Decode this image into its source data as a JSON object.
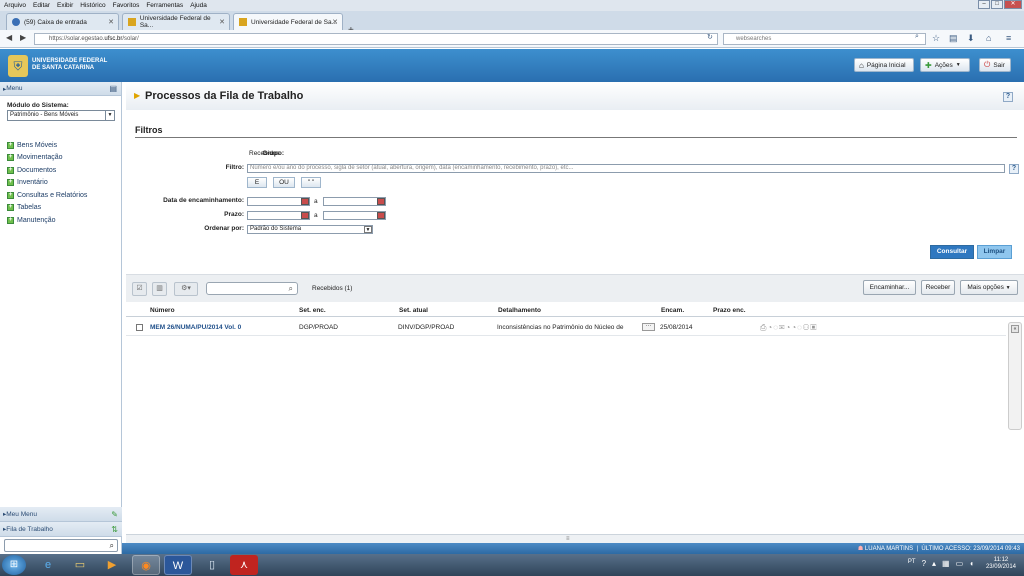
{
  "browser": {
    "menu": [
      "Arquivo",
      "Editar",
      "Exibir",
      "Histórico",
      "Favoritos",
      "Ferramentas",
      "Ajuda"
    ],
    "tabs": [
      {
        "label": "(59) Caixa de entrada"
      },
      {
        "label": "Universidade Federal de Sa..."
      },
      {
        "label": "Universidade Federal de Sa..."
      }
    ],
    "url_prefix": "https://solar.egestao.",
    "url_domain": "ufsc.br",
    "url_suffix": "/solar/",
    "search_placeholder": "websearches"
  },
  "header": {
    "university_line1": "UNIVERSIDADE FEDERAL",
    "university_line2": "DE SANTA CATARINA",
    "btn_home": "Página Inicial",
    "btn_actions": "Ações",
    "btn_exit": "Sair"
  },
  "sidebar": {
    "menu_title": "Menu",
    "module_label": "Módulo do Sistema:",
    "module_value": "Patrimônio - Bens Móveis",
    "items": [
      {
        "label": "Bens Móveis"
      },
      {
        "label": "Movimentação"
      },
      {
        "label": "Documentos"
      },
      {
        "label": "Inventário"
      },
      {
        "label": "Consultas e Relatórios"
      },
      {
        "label": "Tabelas"
      },
      {
        "label": "Manutenção"
      }
    ],
    "my_menu": "Meu Menu",
    "work_queue": "Fila de Trabalho"
  },
  "page": {
    "title": "Processos da Fila de Trabalho",
    "filters_title": "Filtros",
    "group_label": "Grupo:",
    "group_value": "Recebidos",
    "filter_label": "Filtro:",
    "filter_placeholder": "Número e/ou ano do processo, sigla de setor (atual, abertura, origem), data (encaminhamento, recebimento, prazo), etc...",
    "op_and": "E",
    "op_or": "OU",
    "op_quote": "\" \"",
    "date_label": "Data de encaminhamento:",
    "deadline_label": "Prazo:",
    "between": "a",
    "order_label": "Ordenar por:",
    "order_value": "Padrão do Sistema",
    "btn_search": "Consultar",
    "btn_clear": "Limpar"
  },
  "toolbar": {
    "received_count": "Recebidos (1)",
    "btn_forward": "Encaminhar...",
    "btn_receive": "Receber",
    "btn_more": "Mais opções"
  },
  "table": {
    "columns": [
      "Número",
      "Set. enc.",
      "Set. atual",
      "Detalhamento",
      "Encam.",
      "Prazo enc."
    ],
    "rows": [
      {
        "numero": "MEM 26/NUMA/PU/2014 Vol. 0",
        "set_enc": "DGP/PROAD",
        "set_atual": "DINV/DGP/PROAD",
        "detalhamento": "Inconsistências no Patrimônio do Núcleo de",
        "encam": "25/08/2014",
        "prazo": ""
      }
    ]
  },
  "status": {
    "user": "LUANA MARTINS",
    "last_access": "ÚLTIMO ACESSO: 23/09/2014 09:43"
  },
  "taskbar": {
    "lang": "PT",
    "time": "11:12",
    "date": "23/09/2014"
  },
  "colors": {
    "header_blue": "#2a6fb0",
    "primary_button": "#2f78c0",
    "secondary_button": "#8fc6ee"
  }
}
